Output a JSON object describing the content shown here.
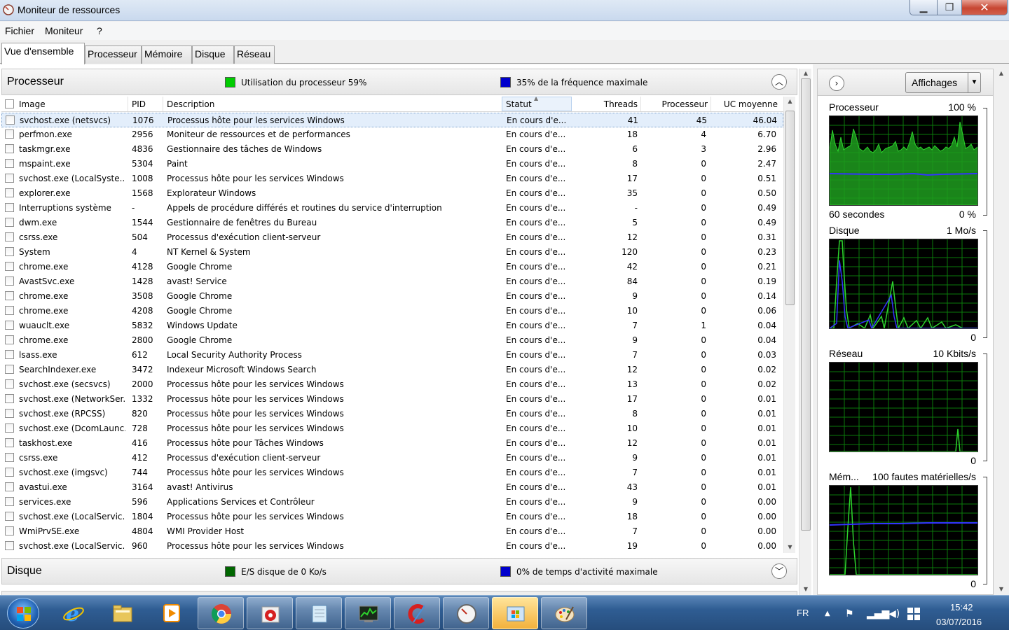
{
  "window": {
    "title": "Moniteur de ressources"
  },
  "menu": {
    "items": [
      "Fichier",
      "Moniteur",
      "?"
    ]
  },
  "tabs": [
    "Vue d'ensemble",
    "Processeur",
    "Mémoire",
    "Disque",
    "Réseau"
  ],
  "processor_section": {
    "title": "Processeur",
    "legend1": "Utilisation du processeur 59%",
    "legend1_color": "#00cc00",
    "legend2": "35% de la fréquence maximale",
    "legend2_color": "#0000cc",
    "columns": [
      "Image",
      "PID",
      "Description",
      "Statut",
      "Threads",
      "Processeur",
      "UC moyenne"
    ],
    "rows": [
      [
        "svchost.exe (netsvcs)",
        "1076",
        "Processus hôte pour les services Windows",
        "En cours d'e...",
        "41",
        "45",
        "46.04"
      ],
      [
        "perfmon.exe",
        "2956",
        "Moniteur de ressources et de performances",
        "En cours d'e...",
        "18",
        "4",
        "6.70"
      ],
      [
        "taskmgr.exe",
        "4836",
        "Gestionnaire des tâches de Windows",
        "En cours d'e...",
        "6",
        "3",
        "2.96"
      ],
      [
        "mspaint.exe",
        "5304",
        "Paint",
        "En cours d'e...",
        "8",
        "0",
        "2.47"
      ],
      [
        "svchost.exe (LocalSyste...",
        "1008",
        "Processus hôte pour les services Windows",
        "En cours d'e...",
        "17",
        "0",
        "0.51"
      ],
      [
        "explorer.exe",
        "1568",
        "Explorateur Windows",
        "En cours d'e...",
        "35",
        "0",
        "0.50"
      ],
      [
        "Interruptions système",
        "-",
        "Appels de procédure différés et routines du service d'interruption",
        "En cours d'e...",
        "-",
        "0",
        "0.49"
      ],
      [
        "dwm.exe",
        "1544",
        "Gestionnaire de fenêtres du Bureau",
        "En cours d'e...",
        "5",
        "0",
        "0.49"
      ],
      [
        "csrss.exe",
        "504",
        "Processus d'exécution client-serveur",
        "En cours d'e...",
        "12",
        "0",
        "0.31"
      ],
      [
        "System",
        "4",
        "NT Kernel & System",
        "En cours d'e...",
        "120",
        "0",
        "0.23"
      ],
      [
        "chrome.exe",
        "4128",
        "Google Chrome",
        "En cours d'e...",
        "42",
        "0",
        "0.21"
      ],
      [
        "AvastSvc.exe",
        "1428",
        "avast! Service",
        "En cours d'e...",
        "84",
        "0",
        "0.19"
      ],
      [
        "chrome.exe",
        "3508",
        "Google Chrome",
        "En cours d'e...",
        "9",
        "0",
        "0.14"
      ],
      [
        "chrome.exe",
        "4208",
        "Google Chrome",
        "En cours d'e...",
        "10",
        "0",
        "0.06"
      ],
      [
        "wuauclt.exe",
        "5832",
        "Windows Update",
        "En cours d'e...",
        "7",
        "1",
        "0.04"
      ],
      [
        "chrome.exe",
        "2800",
        "Google Chrome",
        "En cours d'e...",
        "9",
        "0",
        "0.04"
      ],
      [
        "lsass.exe",
        "612",
        "Local Security Authority Process",
        "En cours d'e...",
        "7",
        "0",
        "0.03"
      ],
      [
        "SearchIndexer.exe",
        "3472",
        "Indexeur Microsoft Windows Search",
        "En cours d'e...",
        "12",
        "0",
        "0.02"
      ],
      [
        "svchost.exe (secsvcs)",
        "2000",
        "Processus hôte pour les services Windows",
        "En cours d'e...",
        "13",
        "0",
        "0.02"
      ],
      [
        "svchost.exe (NetworkSer...",
        "1332",
        "Processus hôte pour les services Windows",
        "En cours d'e...",
        "17",
        "0",
        "0.01"
      ],
      [
        "svchost.exe (RPCSS)",
        "820",
        "Processus hôte pour les services Windows",
        "En cours d'e...",
        "8",
        "0",
        "0.01"
      ],
      [
        "svchost.exe (DcomLaunc...",
        "728",
        "Processus hôte pour les services Windows",
        "En cours d'e...",
        "10",
        "0",
        "0.01"
      ],
      [
        "taskhost.exe",
        "416",
        "Processus hôte pour Tâches Windows",
        "En cours d'e...",
        "12",
        "0",
        "0.01"
      ],
      [
        "csrss.exe",
        "412",
        "Processus d'exécution client-serveur",
        "En cours d'e...",
        "9",
        "0",
        "0.01"
      ],
      [
        "svchost.exe (imgsvc)",
        "744",
        "Processus hôte pour les services Windows",
        "En cours d'e...",
        "7",
        "0",
        "0.01"
      ],
      [
        "avastui.exe",
        "3164",
        "avast! Antivirus",
        "En cours d'e...",
        "43",
        "0",
        "0.01"
      ],
      [
        "services.exe",
        "596",
        "Applications Services et Contrôleur",
        "En cours d'e...",
        "9",
        "0",
        "0.00"
      ],
      [
        "svchost.exe (LocalServic...",
        "1804",
        "Processus hôte pour les services Windows",
        "En cours d'e...",
        "18",
        "0",
        "0.00"
      ],
      [
        "WmiPrvSE.exe",
        "4804",
        "WMI Provider Host",
        "En cours d'e...",
        "7",
        "0",
        "0.00"
      ],
      [
        "svchost.exe (LocalServic...",
        "960",
        "Processus hôte pour les services Windows",
        "En cours d'e...",
        "19",
        "0",
        "0.00"
      ]
    ]
  },
  "disk_section": {
    "title": "Disque",
    "legend1": "E/S disque de 0 Ko/s",
    "legend1_color": "#006600",
    "legend2": "0% de temps d'activité maximale",
    "legend2_color": "#0000cc"
  },
  "right_panel": {
    "view_button": "Affichages",
    "graphs": [
      {
        "name": "Processeur",
        "max": "100 %",
        "min_left": "60 secondes",
        "min": "0 %"
      },
      {
        "name": "Disque",
        "max": "1 Mo/s",
        "min": "0"
      },
      {
        "name": "Réseau",
        "max": "10 Kbits/s",
        "min": "0"
      },
      {
        "name": "Mém...",
        "max": "100 fautes matérielles/s",
        "min": "0"
      }
    ]
  },
  "taskbar": {
    "language": "FR",
    "time": "15:42",
    "date": "03/07/2016"
  }
}
